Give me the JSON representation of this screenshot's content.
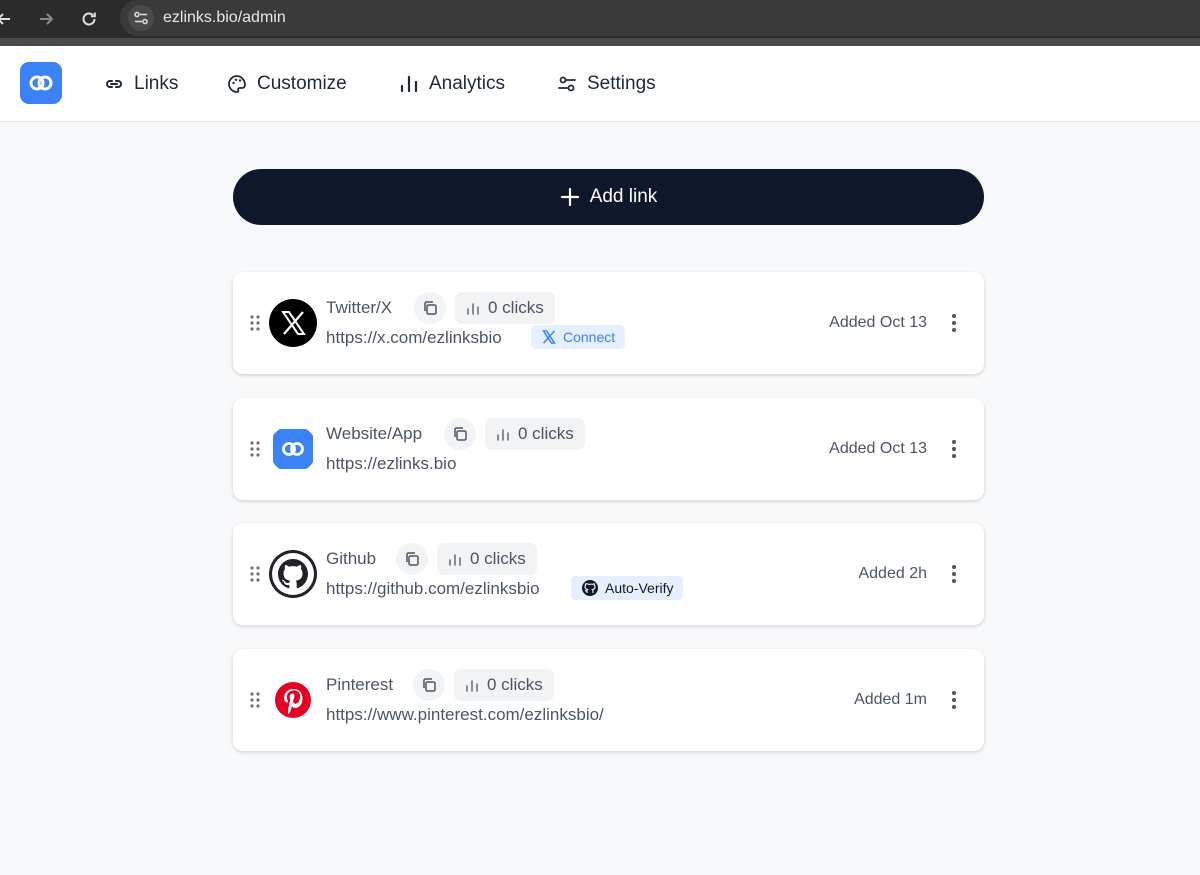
{
  "browser": {
    "url": "ezlinks.bio/admin"
  },
  "nav": {
    "links": "Links",
    "customize": "Customize",
    "analytics": "Analytics",
    "settings": "Settings"
  },
  "add_link_label": "Add link",
  "cards": [
    {
      "title": "Twitter/X",
      "url": "https://x.com/ezlinksbio",
      "clicks": "0 clicks",
      "added": "Added Oct 13",
      "badge": "Connect",
      "icon": "x-logo-icon"
    },
    {
      "title": "Website/App",
      "url": "https://ezlinks.bio",
      "clicks": "0 clicks",
      "added": "Added Oct 13",
      "icon": "ezlinks-logo-icon"
    },
    {
      "title": "Github",
      "url": "https://github.com/ezlinksbio",
      "clicks": "0 clicks",
      "added": "Added 2h",
      "badge": "Auto-Verify",
      "icon": "github-logo-icon"
    },
    {
      "title": "Pinterest",
      "url": "https://www.pinterest.com/ezlinksbio/",
      "clicks": "0 clicks",
      "added": "Added 1m",
      "icon": "pinterest-logo-icon"
    }
  ],
  "colors": {
    "brand": "#3b82f6",
    "dark": "#0f172a",
    "connect": "#3b82f6",
    "pinterest": "#e60023"
  }
}
